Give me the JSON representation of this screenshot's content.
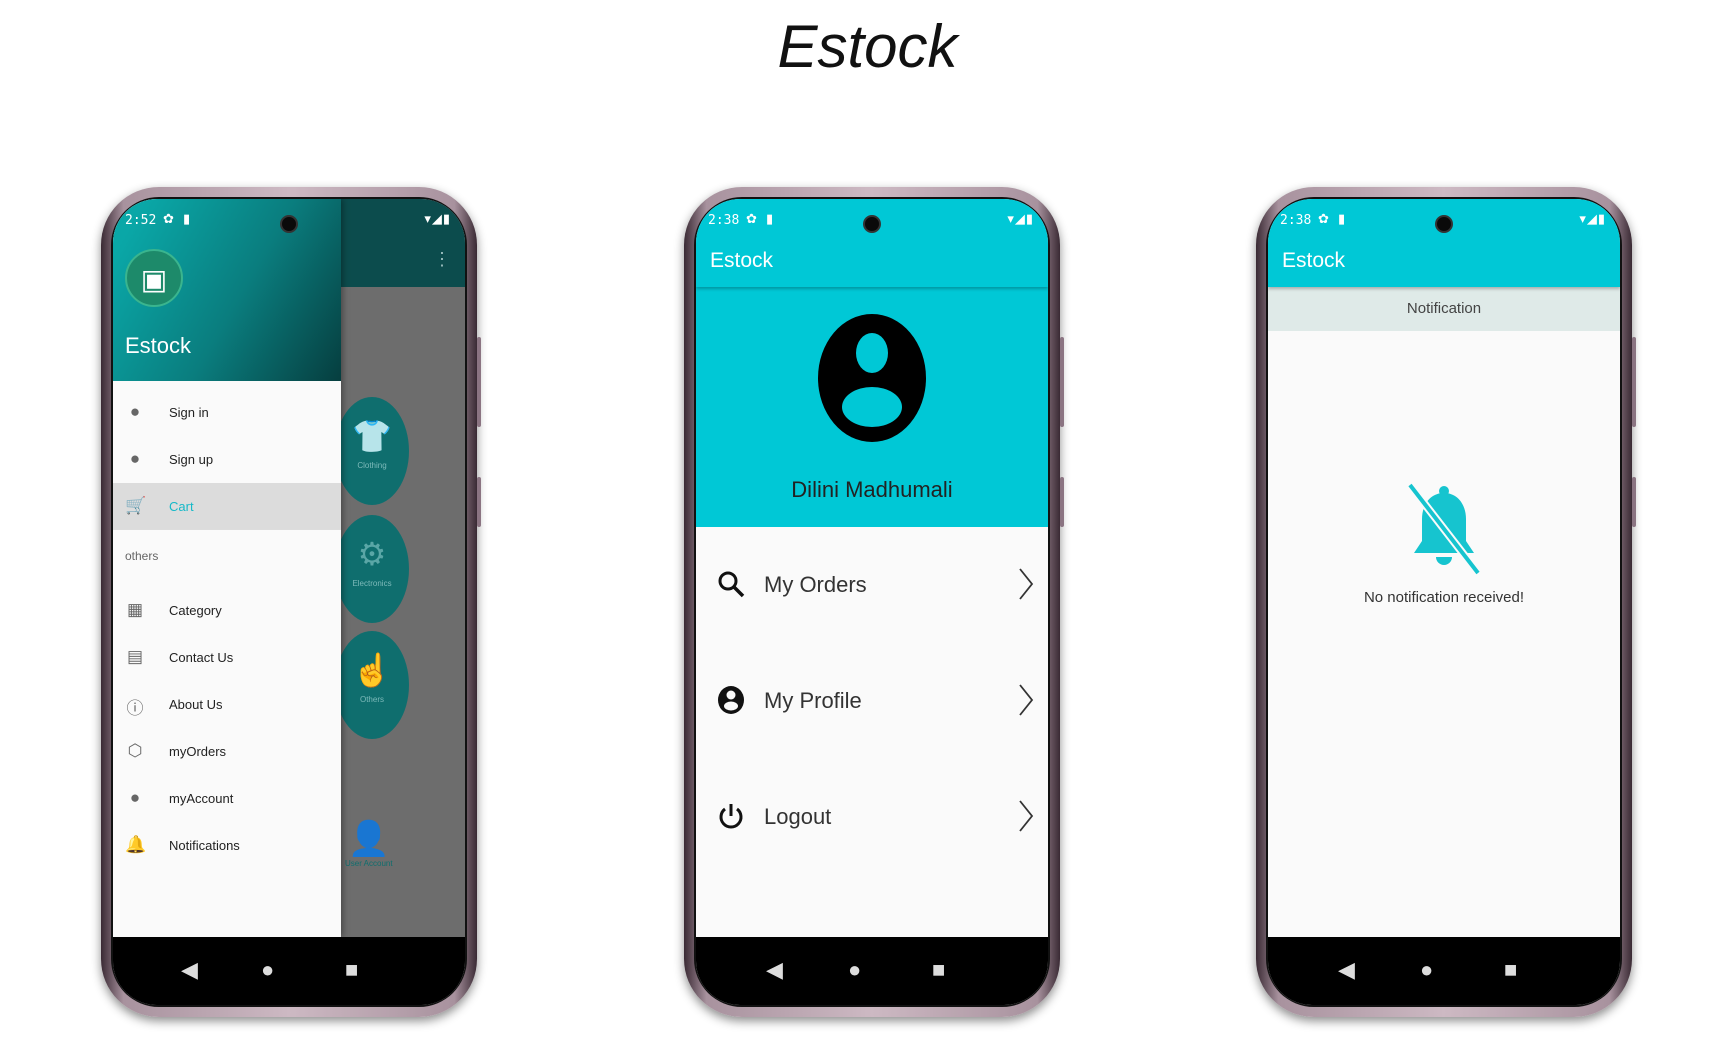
{
  "page_title": "Estock",
  "phone1": {
    "status_time": "2:52",
    "drawer": {
      "app_name": "Estock",
      "items": [
        {
          "label": "Sign in",
          "icon": "account-circle-icon"
        },
        {
          "label": "Sign up",
          "icon": "account-circle-icon"
        },
        {
          "label": "Cart",
          "icon": "cart-icon",
          "active": true
        }
      ],
      "section_label": "others",
      "other_items": [
        {
          "label": "Category",
          "icon": "grid-icon"
        },
        {
          "label": "Contact Us",
          "icon": "contact-card-icon"
        },
        {
          "label": "About Us",
          "icon": "info-icon"
        },
        {
          "label": "myOrders",
          "icon": "package-icon"
        },
        {
          "label": "myAccount",
          "icon": "account-circle-icon"
        },
        {
          "label": "Notifications",
          "icon": "bell-icon"
        }
      ]
    },
    "background_categories": [
      "Clothing",
      "Electronics",
      "Others"
    ],
    "background_user_account": "User Account"
  },
  "phone2": {
    "status_time": "2:38",
    "app_title": "Estock",
    "user_name": "Dilini Madhumali",
    "menu": [
      {
        "label": "My Orders",
        "icon": "search-icon"
      },
      {
        "label": "My Profile",
        "icon": "account-circle-icon"
      },
      {
        "label": "Logout",
        "icon": "power-icon"
      }
    ]
  },
  "phone3": {
    "status_time": "2:38",
    "app_title": "Estock",
    "tab_label": "Notification",
    "empty_message": "No notification received!"
  },
  "colors": {
    "accent": "#00c8d6",
    "drawer_header": "#0a7d7e",
    "scrim": "#6d6d6d"
  }
}
